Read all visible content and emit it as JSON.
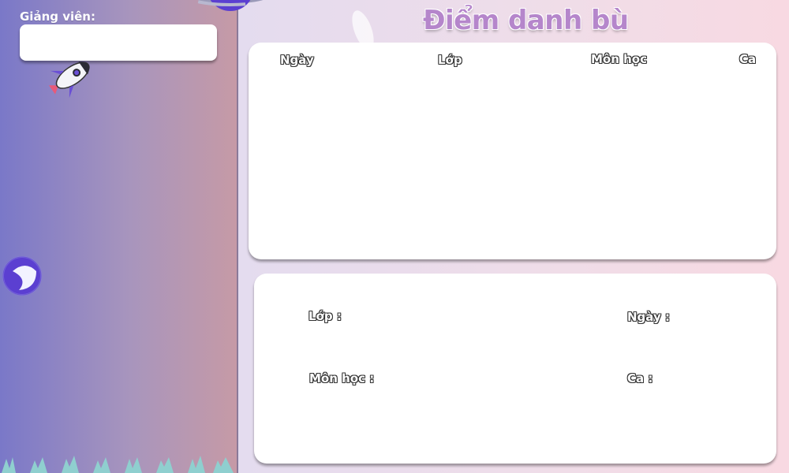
{
  "sidebar": {
    "lecturer_label": "Giảng viên:",
    "lecturer_value": ""
  },
  "page": {
    "title": "Điểm danh bù"
  },
  "table": {
    "columns": [
      "Ngày",
      "Lớp",
      "Môn học",
      "Ca"
    ],
    "rows": []
  },
  "form": {
    "class_label": "Lớp :",
    "date_label": "Ngày :",
    "subject_label": "Môn học :",
    "shift_label": "Ca :"
  }
}
